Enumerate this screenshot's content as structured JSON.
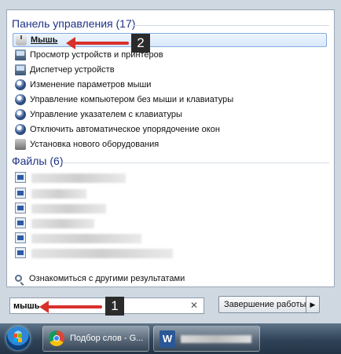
{
  "start_menu": {
    "control_panel_group": {
      "title": "Панель управления (17)",
      "items": [
        {
          "label": "Мышь",
          "icon": "mouse-icon",
          "selected": true
        },
        {
          "label": "Просмотр устройств и принтеров",
          "icon": "devices-icon"
        },
        {
          "label": "Диспетчер устройств",
          "icon": "device-manager-icon"
        },
        {
          "label": "Изменение параметров мыши",
          "icon": "control-panel-icon"
        },
        {
          "label": "Управление компьютером без мыши и клавиатуры",
          "icon": "ease-of-access-icon"
        },
        {
          "label": "Управление указателем с клавиатуры",
          "icon": "ease-of-access-icon"
        },
        {
          "label": "Отключить автоматическое упорядочение окон",
          "icon": "ease-of-access-icon"
        },
        {
          "label": "Установка нового оборудования",
          "icon": "hardware-icon"
        }
      ]
    },
    "files_group": {
      "title": "Файлы (6)",
      "items": [
        {
          "icon": "image-file-icon",
          "label_hidden": true
        },
        {
          "icon": "word-file-icon",
          "label_hidden": true
        },
        {
          "icon": "word-file-icon",
          "label_hidden": true
        },
        {
          "icon": "word-file-icon",
          "label_hidden": true
        },
        {
          "icon": "word-file-icon",
          "label_hidden": true
        },
        {
          "icon": "word-file-icon",
          "label_hidden": true
        }
      ]
    },
    "see_more": {
      "label": "Ознакомиться с другими результатами",
      "icon": "search-icon"
    },
    "search": {
      "value": "мышь",
      "clear_icon": "close-icon"
    },
    "shutdown": {
      "label": "Завершение работы",
      "arrow_icon": "chevron-right-icon"
    }
  },
  "annotations": {
    "badge_1": "1",
    "badge_2": "2",
    "arrow_color": "#d9302b"
  },
  "taskbar": {
    "start_icon": "windows-start-icon",
    "buttons": [
      {
        "label": "Подбор слов - G...",
        "icon": "chrome-icon"
      },
      {
        "icon": "word-icon",
        "icon_text": "W",
        "label_hidden": true
      }
    ]
  },
  "colors": {
    "group_title": "#1e3287",
    "selection_border": "#84acdd",
    "taskbar_top": "#5e7488"
  }
}
